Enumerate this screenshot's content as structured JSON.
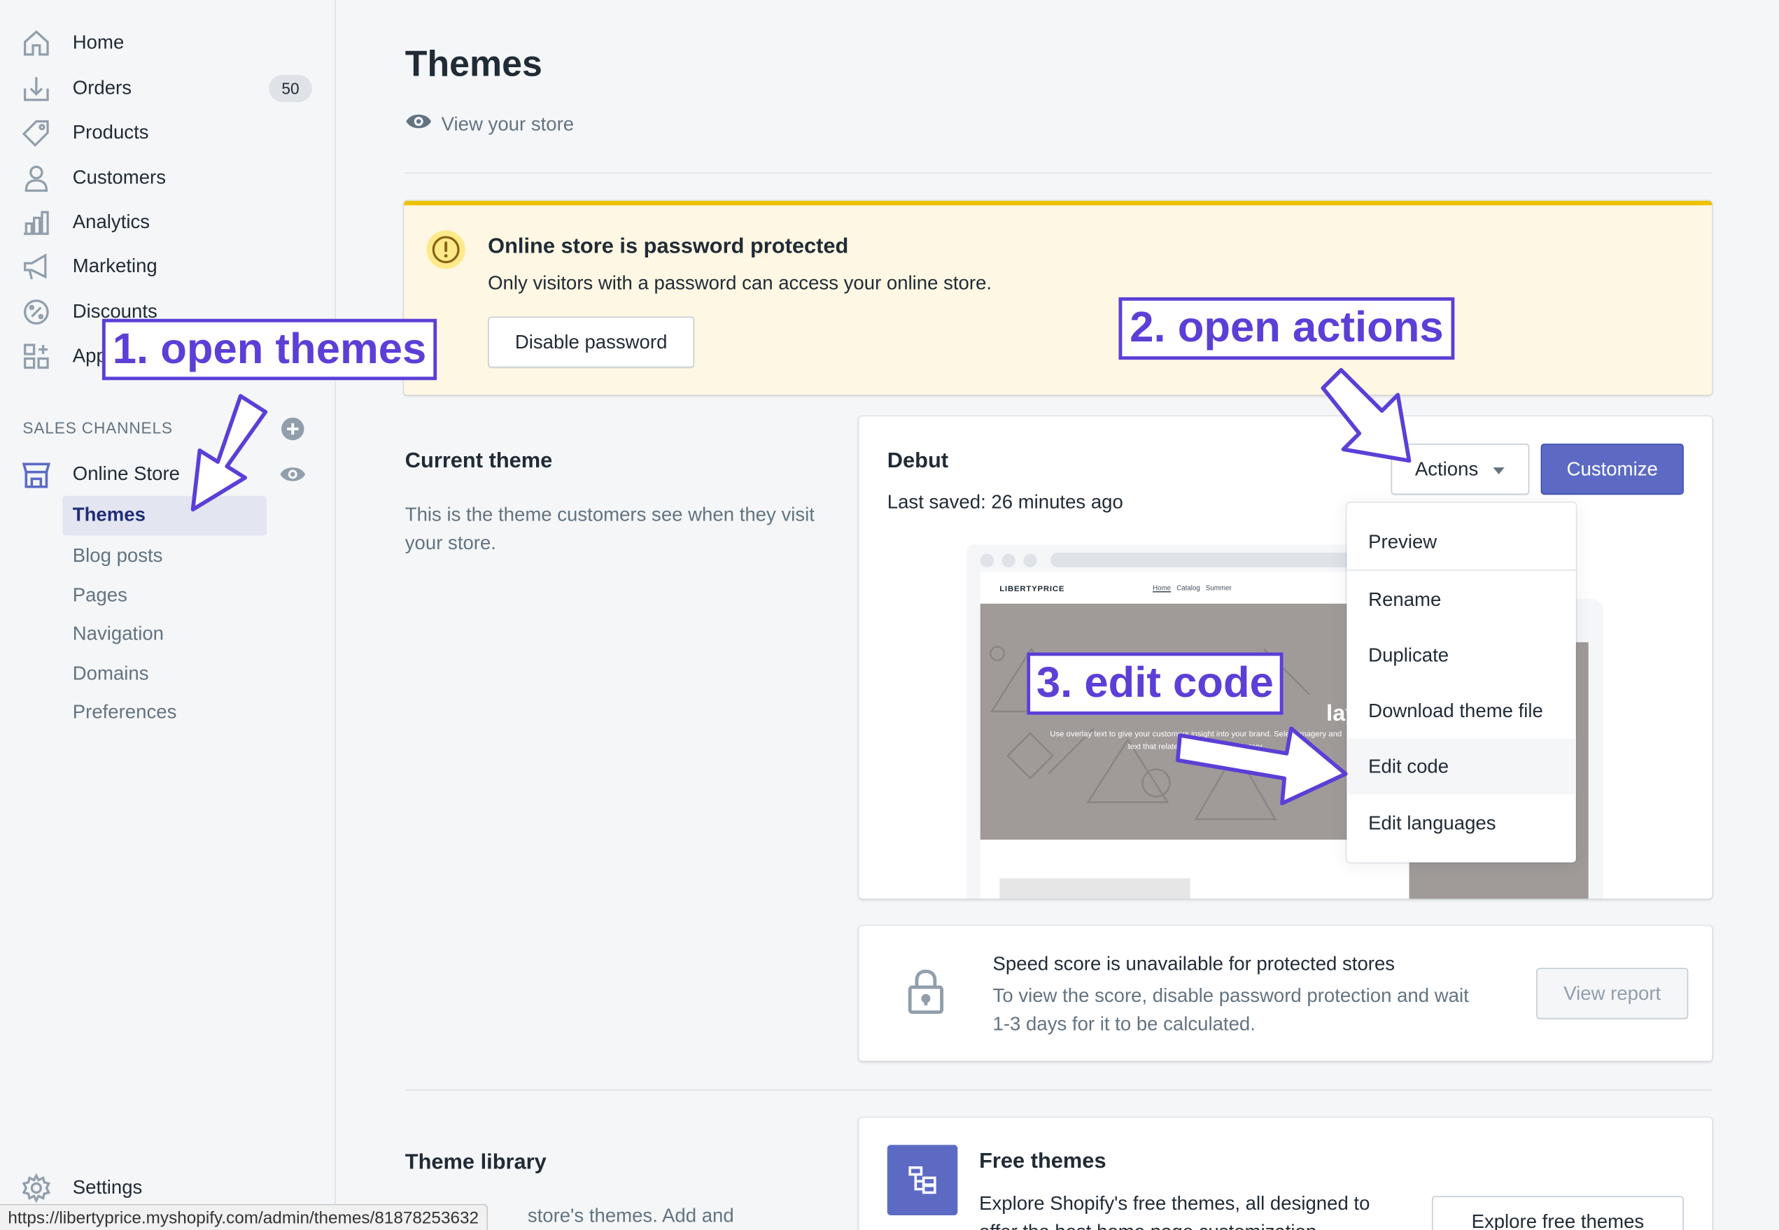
{
  "sidebar": {
    "items": [
      {
        "label": "Home",
        "icon": "home-icon"
      },
      {
        "label": "Orders",
        "icon": "orders-icon",
        "badge": "50"
      },
      {
        "label": "Products",
        "icon": "tag-icon"
      },
      {
        "label": "Customers",
        "icon": "person-icon"
      },
      {
        "label": "Analytics",
        "icon": "bar-chart-icon"
      },
      {
        "label": "Marketing",
        "icon": "megaphone-icon"
      },
      {
        "label": "Discounts",
        "icon": "discount-icon"
      },
      {
        "label": "Apps",
        "icon": "apps-icon"
      }
    ],
    "sales_channels_title": "SALES CHANNELS",
    "online_store": "Online Store",
    "sub_items": [
      "Themes",
      "Blog posts",
      "Pages",
      "Navigation",
      "Domains",
      "Preferences"
    ],
    "settings": "Settings"
  },
  "header": {
    "title": "Themes",
    "view_store": "View your store"
  },
  "banner": {
    "title": "Online store is password protected",
    "text": "Only visitors with a password can access your online store.",
    "button": "Disable password"
  },
  "current_theme": {
    "title": "Current theme",
    "description": "This is the theme customers see when they visit your store.",
    "theme_name": "Debut",
    "last_saved": "Last saved: 26 minutes ago",
    "actions_button": "Actions",
    "customize_button": "Customize",
    "preview": {
      "logo": "LIBERTYPRICE",
      "nav": [
        "Home",
        "Catalog",
        "Summer"
      ],
      "overlay_fragment": "lay",
      "hero_subtext": "Use overlay text to give your customers insight into your brand. Select imagery and text that relates to your style and story."
    }
  },
  "actions_menu": [
    "Preview",
    "Rename",
    "Duplicate",
    "Download theme file",
    "Edit code",
    "Edit languages"
  ],
  "speed": {
    "title": "Speed score is unavailable for protected stores",
    "text": "To view the score, disable password protection and wait 1-3 days for it to be calculated.",
    "button": "View report"
  },
  "theme_library": {
    "title": "Theme library",
    "description_fragment": "store's themes. Add and",
    "free_title": "Free themes",
    "free_text": "Explore Shopify's free themes, all designed to",
    "free_text_cut": "offer the best home page customization",
    "free_button": "Explore free themes"
  },
  "status_bar_url": "https://libertyprice.myshopify.com/admin/themes/81878253632",
  "annotations": {
    "step1": "1. open themes",
    "step2": "2. open actions",
    "step3": "3. edit code"
  },
  "colors": {
    "accent": "#5c6ac4",
    "annotation": "#5b3fd6",
    "warning_border": "#eec200",
    "warning_bg": "#fdf7e3"
  }
}
